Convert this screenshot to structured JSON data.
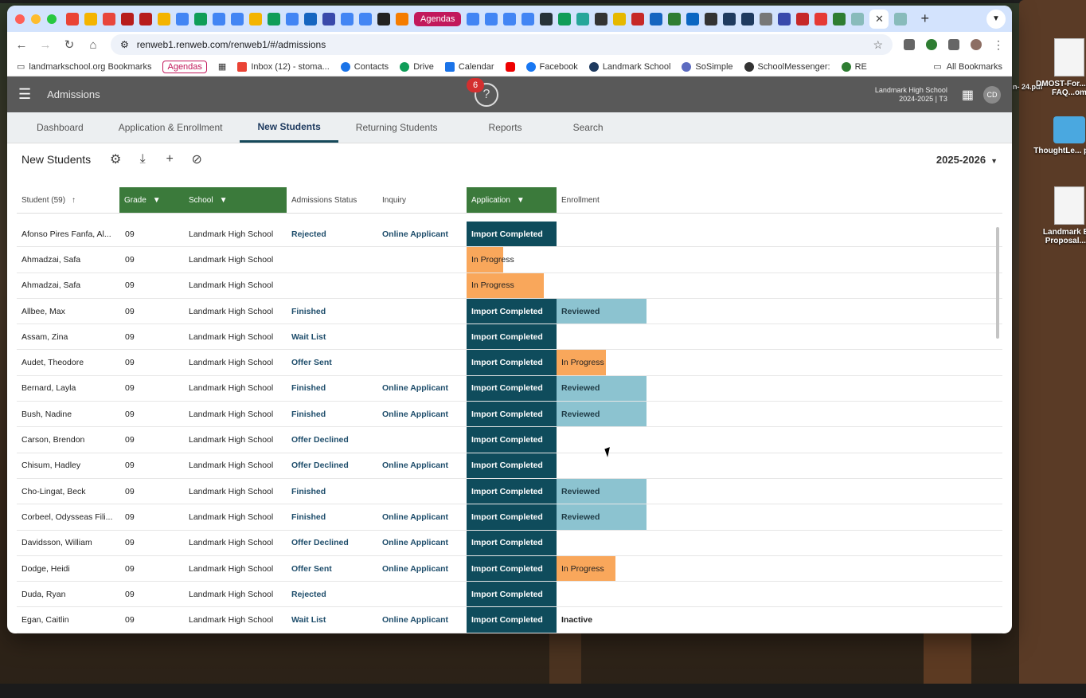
{
  "browser": {
    "url": "renweb1.renweb.com/renweb1/#/admissions",
    "tab_agendas": "Agendas",
    "bookmarks": [
      {
        "label": "landmarkschool.org Bookmarks"
      },
      {
        "label": "Agendas"
      },
      {
        "label": "Inbox (12) - stoma..."
      },
      {
        "label": "Contacts"
      },
      {
        "label": "Drive"
      },
      {
        "label": "Calendar"
      },
      {
        "label": "Facebook"
      },
      {
        "label": "Landmark School"
      },
      {
        "label": "SoSimple"
      },
      {
        "label": "SchoolMessenger:"
      },
      {
        "label": "RE"
      }
    ],
    "all_bookmarks": "All Bookmarks"
  },
  "desktop": {
    "icons": [
      {
        "label": "DMOST-For...and-FAQ...om"
      },
      {
        "label": "ThoughtLe... plcon"
      },
      {
        "label": "Landmark B... Proposal...) ("
      }
    ],
    "partial_text": "n-\n24.pdf"
  },
  "app": {
    "title": "Admissions",
    "notification_count": "6",
    "help": "?",
    "school_name": "Landmark High School",
    "school_term": "2024-2025 | T3",
    "avatar": "CD"
  },
  "navtabs": [
    {
      "label": "Dashboard"
    },
    {
      "label": "Application & Enrollment"
    },
    {
      "label": "New Students"
    },
    {
      "label": "Returning Students"
    },
    {
      "label": "Reports"
    },
    {
      "label": "Search"
    }
  ],
  "subbar": {
    "title": "New Students",
    "year": "2025-2026"
  },
  "table": {
    "headers": {
      "student": "Student (59)",
      "grade": "Grade",
      "school": "School",
      "status": "Admissions Status",
      "inquiry": "Inquiry",
      "application": "Application",
      "enrollment": "Enrollment"
    },
    "rows": [
      {
        "student": "Afonso Pires Fanfa, Al...",
        "grade": "09",
        "school": "Landmark High School",
        "status": "Rejected",
        "inquiry": "Online Applicant",
        "application": "Import Completed",
        "enrollment": ""
      },
      {
        "student": "Ahmadzai, Safa",
        "grade": "09",
        "school": "Landmark High School",
        "status": "",
        "inquiry": "",
        "application": "In Progress",
        "enrollment": ""
      },
      {
        "student": "Ahmadzai, Safa",
        "grade": "09",
        "school": "Landmark High School",
        "status": "",
        "inquiry": "",
        "application": "In Progress",
        "enrollment": ""
      },
      {
        "student": "Allbee, Max",
        "grade": "09",
        "school": "Landmark High School",
        "status": "Finished",
        "inquiry": "",
        "application": "Import Completed",
        "enrollment": "Reviewed"
      },
      {
        "student": "Assam, Zina",
        "grade": "09",
        "school": "Landmark High School",
        "status": "Wait List",
        "inquiry": "",
        "application": "Import Completed",
        "enrollment": ""
      },
      {
        "student": "Audet, Theodore",
        "grade": "09",
        "school": "Landmark High School",
        "status": "Offer Sent",
        "inquiry": "",
        "application": "Import Completed",
        "enrollment": "In Progress"
      },
      {
        "student": "Bernard, Layla",
        "grade": "09",
        "school": "Landmark High School",
        "status": "Finished",
        "inquiry": "Online Applicant",
        "application": "Import Completed",
        "enrollment": "Reviewed"
      },
      {
        "student": "Bush, Nadine",
        "grade": "09",
        "school": "Landmark High School",
        "status": "Finished",
        "inquiry": "Online Applicant",
        "application": "Import Completed",
        "enrollment": "Reviewed"
      },
      {
        "student": "Carson, Brendon",
        "grade": "09",
        "school": "Landmark High School",
        "status": "Offer Declined",
        "inquiry": "",
        "application": "Import Completed",
        "enrollment": ""
      },
      {
        "student": "Chisum, Hadley",
        "grade": "09",
        "school": "Landmark High School",
        "status": "Offer Declined",
        "inquiry": "Online Applicant",
        "application": "Import Completed",
        "enrollment": ""
      },
      {
        "student": "Cho-Lingat, Beck",
        "grade": "09",
        "school": "Landmark High School",
        "status": "Finished",
        "inquiry": "",
        "application": "Import Completed",
        "enrollment": "Reviewed"
      },
      {
        "student": "Corbeel, Odysseas Fili...",
        "grade": "09",
        "school": "Landmark High School",
        "status": "Finished",
        "inquiry": "Online Applicant",
        "application": "Import Completed",
        "enrollment": "Reviewed"
      },
      {
        "student": "Davidsson, William",
        "grade": "09",
        "school": "Landmark High School",
        "status": "Offer Declined",
        "inquiry": "Online Applicant",
        "application": "Import Completed",
        "enrollment": ""
      },
      {
        "student": "Dodge, Heidi",
        "grade": "09",
        "school": "Landmark High School",
        "status": "Offer Sent",
        "inquiry": "Online Applicant",
        "application": "Import Completed",
        "enrollment": "In Progress"
      },
      {
        "student": "Duda, Ryan",
        "grade": "09",
        "school": "Landmark High School",
        "status": "Rejected",
        "inquiry": "",
        "application": "Import Completed",
        "enrollment": ""
      },
      {
        "student": "Egan, Caitlin",
        "grade": "09",
        "school": "Landmark High School",
        "status": "Wait List",
        "inquiry": "Online Applicant",
        "application": "Import Completed",
        "enrollment": "Inactive"
      }
    ]
  },
  "colors": {
    "import": "#0f4c5c",
    "in_progress": "#f9a75b",
    "reviewed": "#8cc3d0",
    "header_green": "#3b7a3b"
  }
}
